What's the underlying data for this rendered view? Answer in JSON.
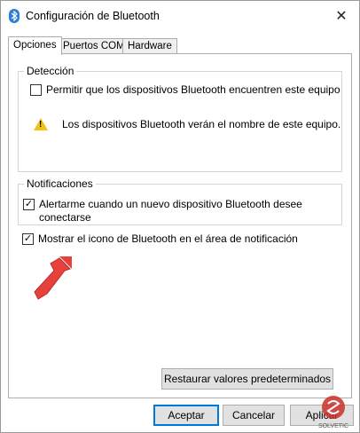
{
  "window": {
    "title": "Configuración de Bluetooth",
    "close_glyph": "✕"
  },
  "tabs": [
    {
      "label": "Opciones",
      "active": true
    },
    {
      "label": "Puertos COM",
      "active": false
    },
    {
      "label": "Hardware",
      "active": false
    }
  ],
  "detection": {
    "legend": "Detección",
    "allow_discovery_label": "Permitir que los dispositivos Bluetooth encuentren este equipo",
    "allow_discovery_checked": false,
    "warning_text": "Los dispositivos Bluetooth verán el nombre de este equipo."
  },
  "notifications": {
    "legend": "Notificaciones",
    "alert_label_line1": "Alertarme cuando un nuevo dispositivo Bluetooth desee",
    "alert_label_line2": "conectarse",
    "alert_checked": true
  },
  "show_icon": {
    "label": "Mostrar el icono de Bluetooth en el área de notificación",
    "checked": true
  },
  "buttons": {
    "restore": "Restaurar valores predeterminados",
    "accept": "Aceptar",
    "cancel": "Cancelar",
    "apply": "Aplicar"
  },
  "watermark": {
    "text": "SOLVETIC"
  },
  "check_glyph": "✓",
  "colors": {
    "accent": "#0078d7",
    "arrow": "#e8413c",
    "bluetooth": "#2d7dd2",
    "warning": "#f2c21b"
  },
  "icons": [
    "bluetooth-icon",
    "close-icon",
    "warning-icon",
    "red-arrow-icon",
    "check-icon",
    "solvetic-logo"
  ]
}
